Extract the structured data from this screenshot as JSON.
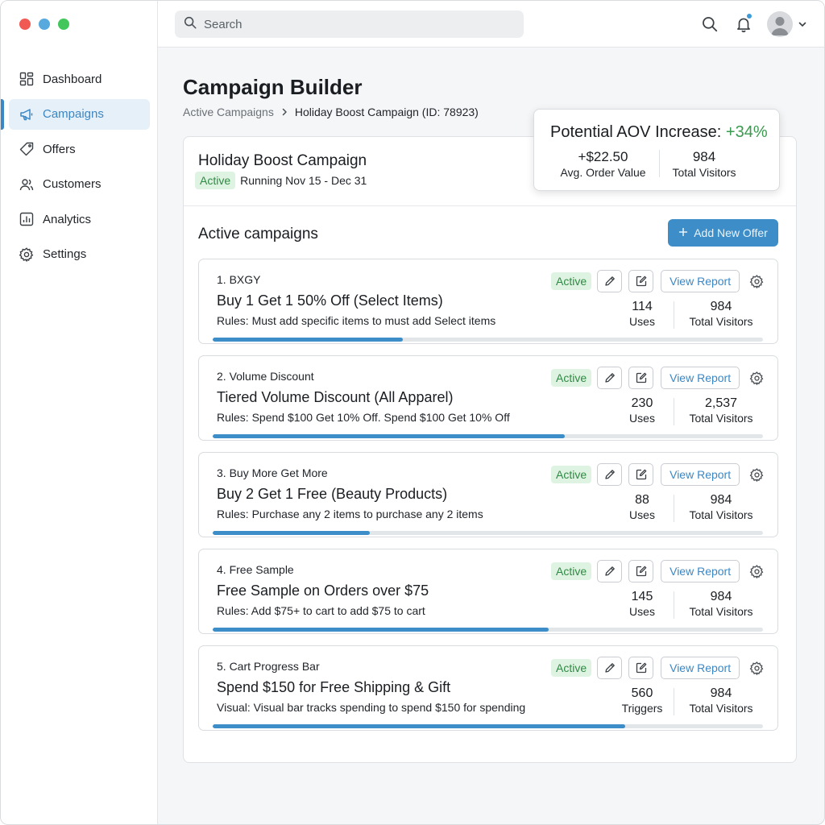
{
  "window": {
    "controls": [
      {
        "name": "close",
        "color": "#f05a52"
      },
      {
        "name": "minimize",
        "color": "#57a9de"
      },
      {
        "name": "maximize",
        "color": "#43c65b"
      }
    ]
  },
  "sidebar": {
    "items": [
      {
        "label": "Dashboard",
        "icon": "dashboard-grid-icon",
        "active": false
      },
      {
        "label": "Campaigns",
        "icon": "megaphone-icon",
        "active": true
      },
      {
        "label": "Offers",
        "icon": "tag-icon",
        "active": false
      },
      {
        "label": "Customers",
        "icon": "users-icon",
        "active": false
      },
      {
        "label": "Analytics",
        "icon": "bar-chart-icon",
        "active": false
      },
      {
        "label": "Settings",
        "icon": "gear-icon",
        "active": false
      }
    ]
  },
  "topbar": {
    "search_placeholder": "Search",
    "icons": [
      "search-icon",
      "bell-icon",
      "avatar",
      "chevron-down-icon"
    ]
  },
  "page": {
    "title": "Campaign Builder",
    "breadcrumb": {
      "parent": "Active Campaigns",
      "current": "Holiday Boost Campaign (ID: 78923)"
    }
  },
  "campaign": {
    "name": "Holiday Boost Campaign",
    "status": "Active",
    "dates": "Running Nov 15 - Dec 31"
  },
  "aov": {
    "title": "Potential AOV Increase:",
    "increase": "+34%",
    "avg_value": "+$22.50",
    "avg_label": "Avg. Order Value",
    "visitors": "984",
    "visitors_label": "Total Visitors"
  },
  "section": {
    "title": "Active campaigns",
    "add_button": "Add New Offer"
  },
  "offer_buttons": {
    "report_label": "View Report"
  },
  "offers": [
    {
      "type": "1. BXGY",
      "title": "Buy 1 Get 1 50% Off (Select Items)",
      "rules": "Rules: Must add specific items to must add Select items",
      "status": "Active",
      "metric_value": "114",
      "metric_label": "Uses",
      "visitors": "984",
      "visitors_label": "Total Visitors",
      "progress": 0.345
    },
    {
      "type": "2. Volume Discount",
      "title": "Tiered Volume Discount (All Apparel)",
      "rules": "Rules: Spend $100 Get 10% Off. Spend $100 Get 10% Off",
      "status": "Active",
      "metric_value": "230",
      "metric_label": "Uses",
      "visitors": "2,537",
      "visitors_label": "Total Visitors",
      "progress": 0.64
    },
    {
      "type": "3. Buy More Get More",
      "title": "Buy 2 Get 1 Free (Beauty Products)",
      "rules": "Rules: Purchase any 2 items to purchase any 2 items",
      "status": "Active",
      "metric_value": "88",
      "metric_label": "Uses",
      "visitors": "984",
      "visitors_label": "Total Visitors",
      "progress": 0.285
    },
    {
      "type": "4. Free Sample",
      "title": "Free Sample on Orders over $75",
      "rules": "Rules: Add $75+ to cart to add $75 to cart",
      "status": "Active",
      "metric_value": "145",
      "metric_label": "Uses",
      "visitors": "984",
      "visitors_label": "Total Visitors",
      "progress": 0.61
    },
    {
      "type": "5. Cart Progress Bar",
      "title": "Spend $150 for Free Shipping & Gift",
      "rules": "Visual: Visual bar tracks spending to spend $150 for spending",
      "status": "Active",
      "metric_value": "560",
      "metric_label": "Triggers",
      "visitors": "984",
      "visitors_label": "Total Visitors",
      "progress": 0.75
    }
  ],
  "colors": {
    "accent": "#3b87c4",
    "active_bg": "#dff3e2",
    "active_text": "#2f8a43",
    "increase_green": "#3a9a4f"
  }
}
